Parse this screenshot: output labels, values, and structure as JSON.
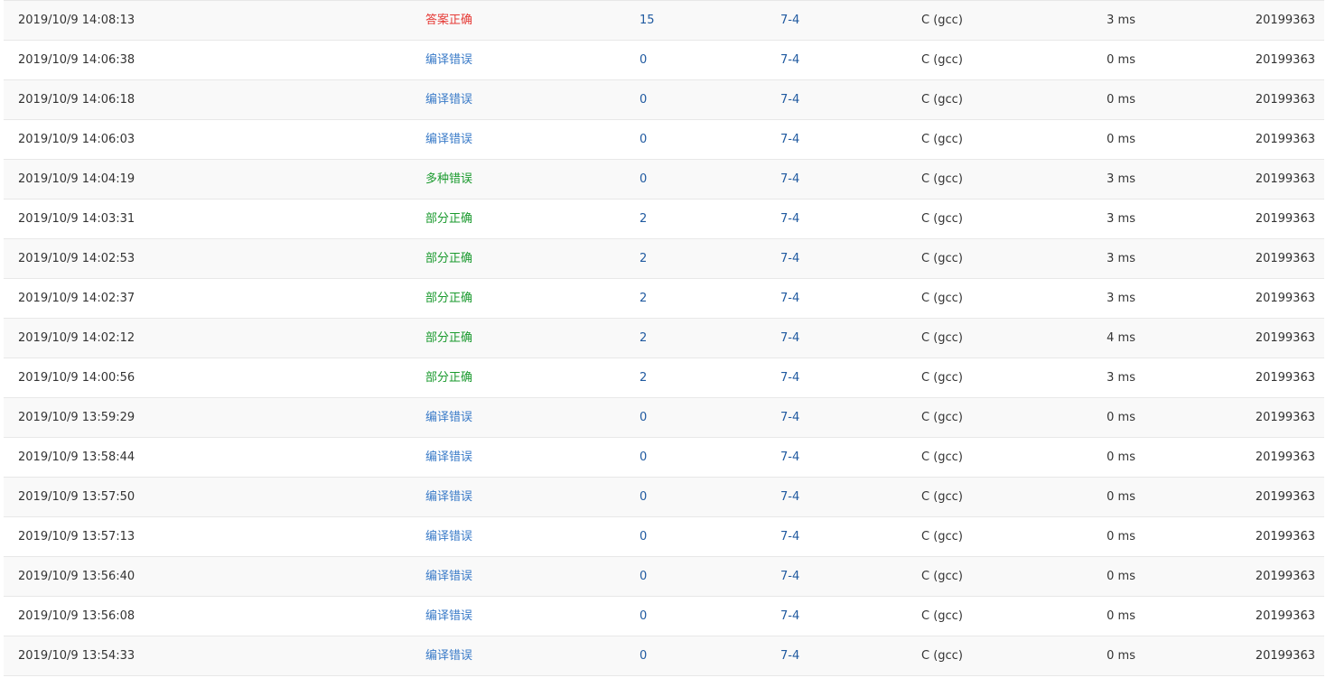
{
  "colors": {
    "accepted": "#e53935",
    "compile_error": "#3a7bc8",
    "partial_or_multiple": "#1a9a2e",
    "link": "#205aa0"
  },
  "rows": [
    {
      "time": "2019/10/9 14:08:13",
      "status": "答案正确",
      "status_type": "red",
      "score": "15",
      "problem": "7-4",
      "language": "C (gcc)",
      "time_used": "3 ms",
      "user": "20199363"
    },
    {
      "time": "2019/10/9 14:06:38",
      "status": "编译错误",
      "status_type": "blue",
      "score": "0",
      "problem": "7-4",
      "language": "C (gcc)",
      "time_used": "0 ms",
      "user": "20199363"
    },
    {
      "time": "2019/10/9 14:06:18",
      "status": "编译错误",
      "status_type": "blue",
      "score": "0",
      "problem": "7-4",
      "language": "C (gcc)",
      "time_used": "0 ms",
      "user": "20199363"
    },
    {
      "time": "2019/10/9 14:06:03",
      "status": "编译错误",
      "status_type": "blue",
      "score": "0",
      "problem": "7-4",
      "language": "C (gcc)",
      "time_used": "0 ms",
      "user": "20199363"
    },
    {
      "time": "2019/10/9 14:04:19",
      "status": "多种错误",
      "status_type": "green",
      "score": "0",
      "problem": "7-4",
      "language": "C (gcc)",
      "time_used": "3 ms",
      "user": "20199363"
    },
    {
      "time": "2019/10/9 14:03:31",
      "status": "部分正确",
      "status_type": "green",
      "score": "2",
      "problem": "7-4",
      "language": "C (gcc)",
      "time_used": "3 ms",
      "user": "20199363"
    },
    {
      "time": "2019/10/9 14:02:53",
      "status": "部分正确",
      "status_type": "green",
      "score": "2",
      "problem": "7-4",
      "language": "C (gcc)",
      "time_used": "3 ms",
      "user": "20199363"
    },
    {
      "time": "2019/10/9 14:02:37",
      "status": "部分正确",
      "status_type": "green",
      "score": "2",
      "problem": "7-4",
      "language": "C (gcc)",
      "time_used": "3 ms",
      "user": "20199363"
    },
    {
      "time": "2019/10/9 14:02:12",
      "status": "部分正确",
      "status_type": "green",
      "score": "2",
      "problem": "7-4",
      "language": "C (gcc)",
      "time_used": "4 ms",
      "user": "20199363"
    },
    {
      "time": "2019/10/9 14:00:56",
      "status": "部分正确",
      "status_type": "green",
      "score": "2",
      "problem": "7-4",
      "language": "C (gcc)",
      "time_used": "3 ms",
      "user": "20199363"
    },
    {
      "time": "2019/10/9 13:59:29",
      "status": "编译错误",
      "status_type": "blue",
      "score": "0",
      "problem": "7-4",
      "language": "C (gcc)",
      "time_used": "0 ms",
      "user": "20199363"
    },
    {
      "time": "2019/10/9 13:58:44",
      "status": "编译错误",
      "status_type": "blue",
      "score": "0",
      "problem": "7-4",
      "language": "C (gcc)",
      "time_used": "0 ms",
      "user": "20199363"
    },
    {
      "time": "2019/10/9 13:57:50",
      "status": "编译错误",
      "status_type": "blue",
      "score": "0",
      "problem": "7-4",
      "language": "C (gcc)",
      "time_used": "0 ms",
      "user": "20199363"
    },
    {
      "time": "2019/10/9 13:57:13",
      "status": "编译错误",
      "status_type": "blue",
      "score": "0",
      "problem": "7-4",
      "language": "C (gcc)",
      "time_used": "0 ms",
      "user": "20199363"
    },
    {
      "time": "2019/10/9 13:56:40",
      "status": "编译错误",
      "status_type": "blue",
      "score": "0",
      "problem": "7-4",
      "language": "C (gcc)",
      "time_used": "0 ms",
      "user": "20199363"
    },
    {
      "time": "2019/10/9 13:56:08",
      "status": "编译错误",
      "status_type": "blue",
      "score": "0",
      "problem": "7-4",
      "language": "C (gcc)",
      "time_used": "0 ms",
      "user": "20199363"
    },
    {
      "time": "2019/10/9 13:54:33",
      "status": "编译错误",
      "status_type": "blue",
      "score": "0",
      "problem": "7-4",
      "language": "C (gcc)",
      "time_used": "0 ms",
      "user": "20199363"
    }
  ]
}
